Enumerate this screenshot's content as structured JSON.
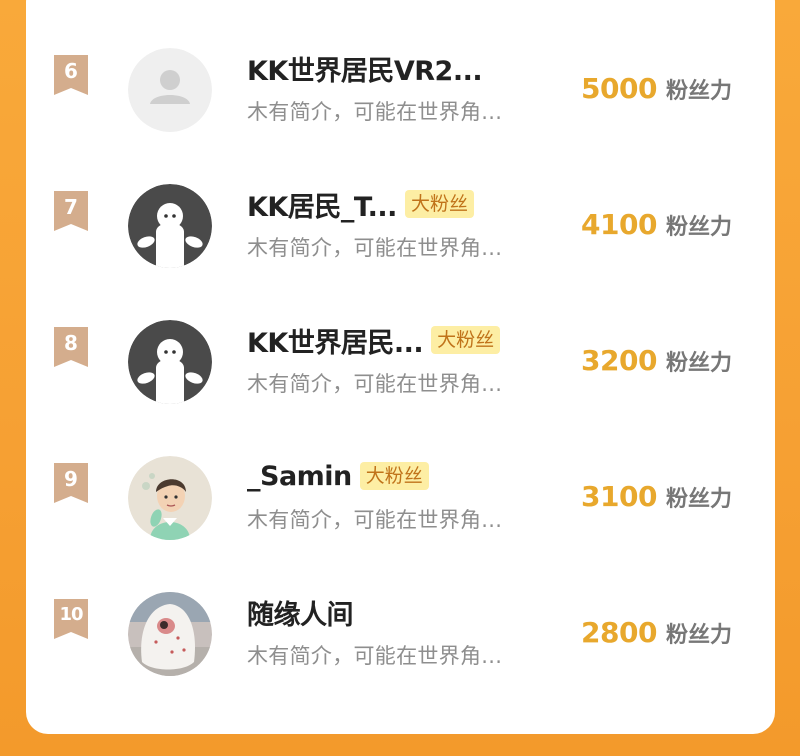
{
  "colors": {
    "background": "#f7a336",
    "card": "#ffffff",
    "rank_badge": "#d4ad8d",
    "score": "#e8a82d",
    "fan_badge_bg": "#fdeea4",
    "fan_badge_text": "#c0731a"
  },
  "score_unit": "粉丝力",
  "rows": [
    {
      "rank": "6",
      "name": "KK世界居民VR2...",
      "badge": "",
      "bio": "木有简介，可能在世界角...",
      "score": "5000",
      "avatar_icon": "default-user-icon"
    },
    {
      "rank": "7",
      "name": "KK居民_T...",
      "badge": "大粉丝",
      "bio": "木有简介，可能在世界角...",
      "score": "4100",
      "avatar_icon": "ghost-avatar-icon"
    },
    {
      "rank": "8",
      "name": "KK世界居民...",
      "badge": "大粉丝",
      "bio": "木有简介，可能在世界角...",
      "score": "3200",
      "avatar_icon": "ghost-avatar-icon"
    },
    {
      "rank": "9",
      "name": "_Samin",
      "badge": "大粉丝",
      "bio": "木有简介，可能在世界角...",
      "score": "3100",
      "avatar_icon": "cartoon-boy-avatar"
    },
    {
      "rank": "10",
      "name": "随缘人间",
      "badge": "",
      "bio": "木有简介，可能在世界角...",
      "score": "2800",
      "avatar_icon": "photo-avatar"
    }
  ]
}
